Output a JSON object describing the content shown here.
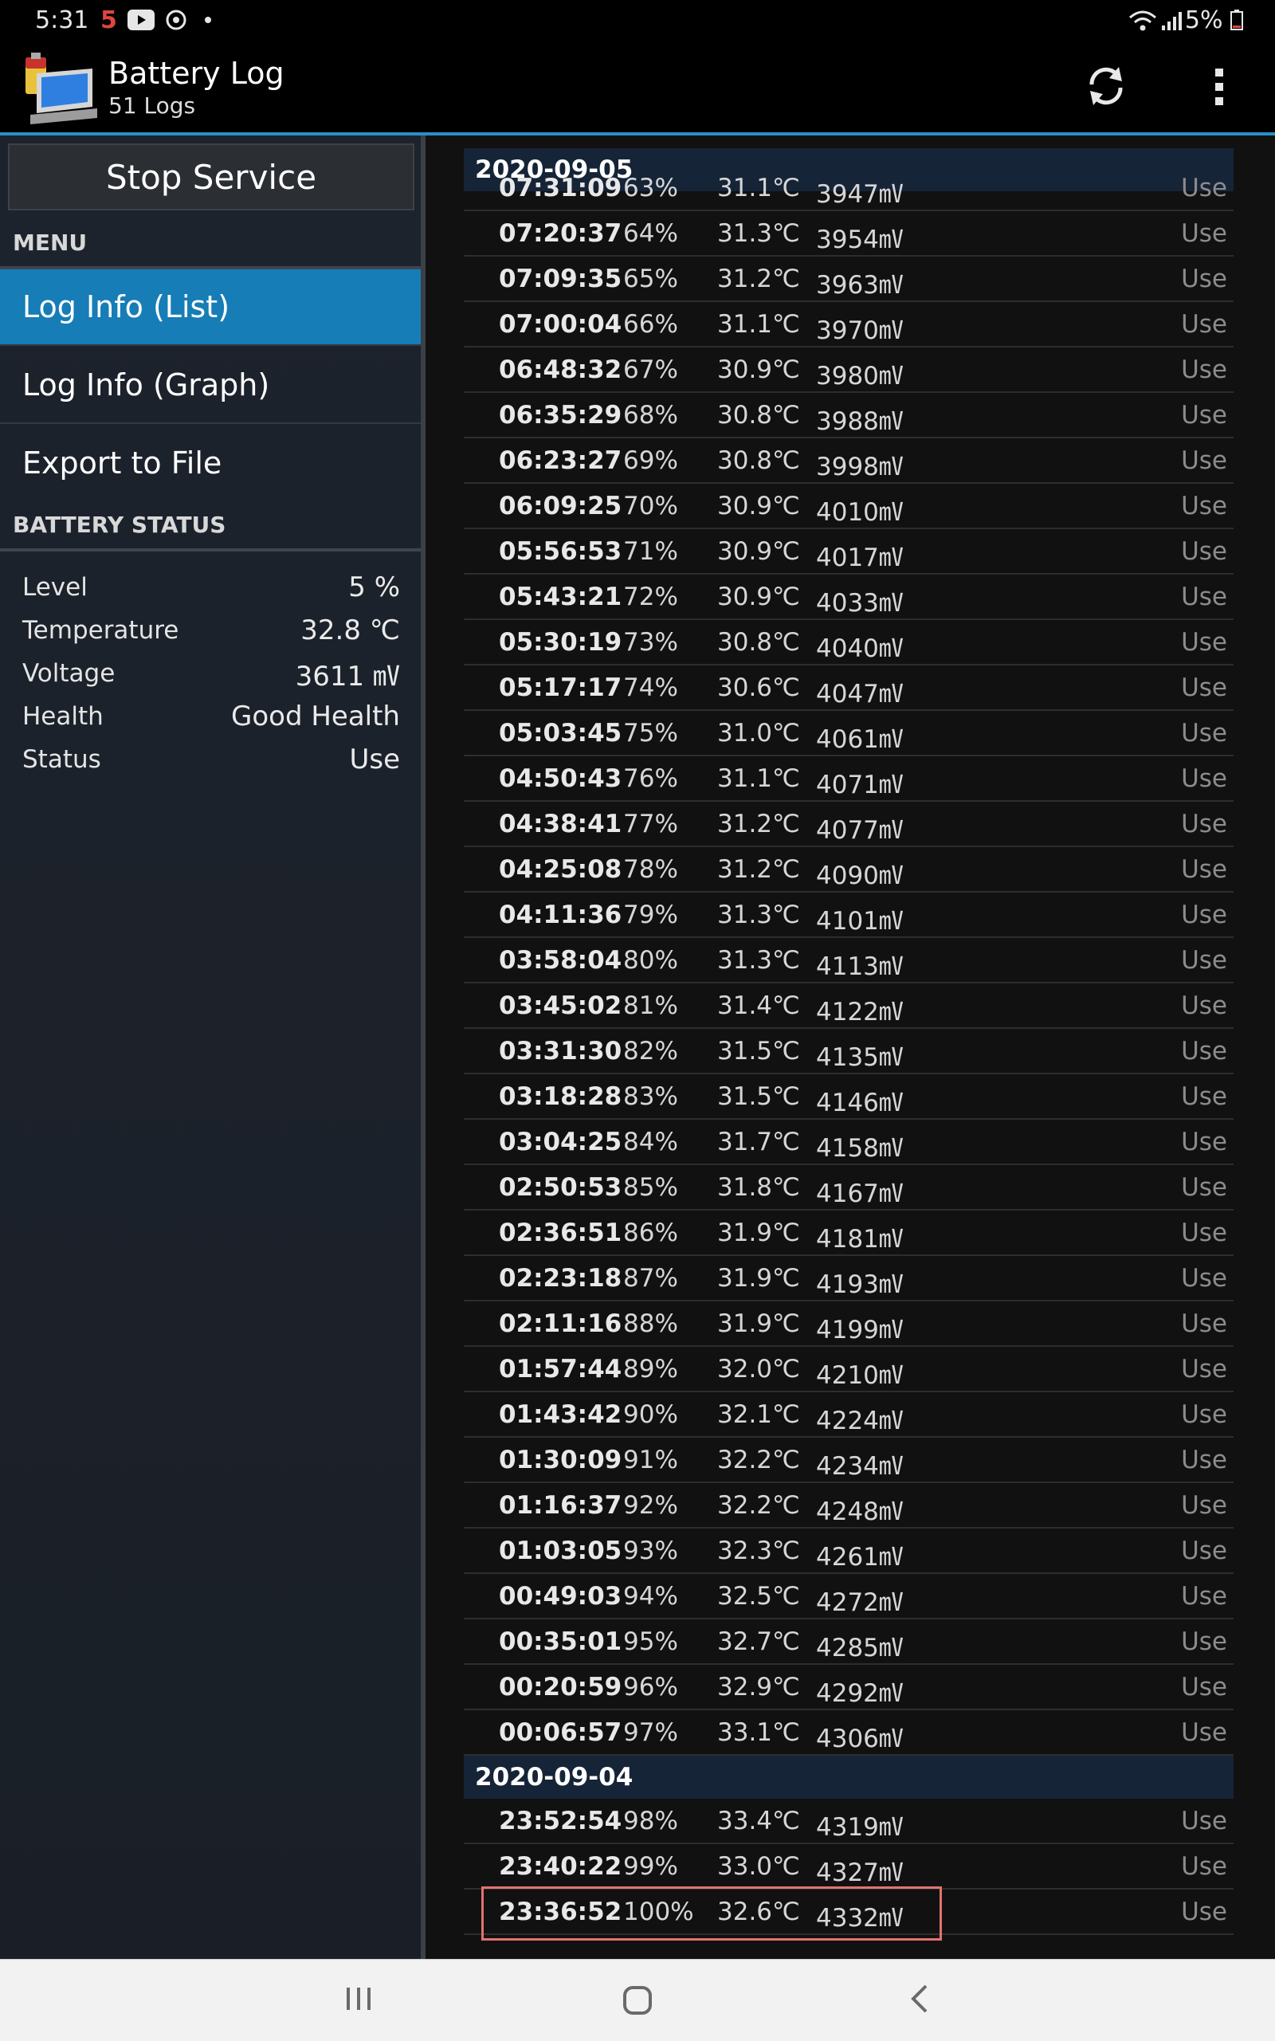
{
  "status_bar": {
    "time": "5:31",
    "notif_count": "5",
    "battery": "5%"
  },
  "app_bar": {
    "title": "Battery Log",
    "subtitle": "51 Logs"
  },
  "sidebar": {
    "stop_button": "Stop Service",
    "menu_header": "MENU",
    "menu_items": [
      "Log Info (List)",
      "Log Info (Graph)",
      "Export to File"
    ],
    "battery_header": "BATTERY STATUS",
    "battery_status": [
      {
        "label": "Level",
        "value": "5 %"
      },
      {
        "label": "Temperature",
        "value": "32.8 ℃"
      },
      {
        "label": "Voltage",
        "value": "3611 ㎷"
      },
      {
        "label": "Health",
        "value": "Good Health"
      },
      {
        "label": "Status",
        "value": "Use"
      }
    ]
  },
  "logs": {
    "date1": "2020-09-05",
    "date2": "2020-09-04",
    "group1": [
      {
        "time": "07:31:09",
        "level": "63%",
        "temp": "31.1℃",
        "volt": "3947㎷",
        "status": "Use"
      },
      {
        "time": "07:20:37",
        "level": "64%",
        "temp": "31.3℃",
        "volt": "3954㎷",
        "status": "Use"
      },
      {
        "time": "07:09:35",
        "level": "65%",
        "temp": "31.2℃",
        "volt": "3963㎷",
        "status": "Use"
      },
      {
        "time": "07:00:04",
        "level": "66%",
        "temp": "31.1℃",
        "volt": "3970㎷",
        "status": "Use"
      },
      {
        "time": "06:48:32",
        "level": "67%",
        "temp": "30.9℃",
        "volt": "3980㎷",
        "status": "Use"
      },
      {
        "time": "06:35:29",
        "level": "68%",
        "temp": "30.8℃",
        "volt": "3988㎷",
        "status": "Use"
      },
      {
        "time": "06:23:27",
        "level": "69%",
        "temp": "30.8℃",
        "volt": "3998㎷",
        "status": "Use"
      },
      {
        "time": "06:09:25",
        "level": "70%",
        "temp": "30.9℃",
        "volt": "4010㎷",
        "status": "Use"
      },
      {
        "time": "05:56:53",
        "level": "71%",
        "temp": "30.9℃",
        "volt": "4017㎷",
        "status": "Use"
      },
      {
        "time": "05:43:21",
        "level": "72%",
        "temp": "30.9℃",
        "volt": "4033㎷",
        "status": "Use"
      },
      {
        "time": "05:30:19",
        "level": "73%",
        "temp": "30.8℃",
        "volt": "4040㎷",
        "status": "Use"
      },
      {
        "time": "05:17:17",
        "level": "74%",
        "temp": "30.6℃",
        "volt": "4047㎷",
        "status": "Use"
      },
      {
        "time": "05:03:45",
        "level": "75%",
        "temp": "31.0℃",
        "volt": "4061㎷",
        "status": "Use"
      },
      {
        "time": "04:50:43",
        "level": "76%",
        "temp": "31.1℃",
        "volt": "4071㎷",
        "status": "Use"
      },
      {
        "time": "04:38:41",
        "level": "77%",
        "temp": "31.2℃",
        "volt": "4077㎷",
        "status": "Use"
      },
      {
        "time": "04:25:08",
        "level": "78%",
        "temp": "31.2℃",
        "volt": "4090㎷",
        "status": "Use"
      },
      {
        "time": "04:11:36",
        "level": "79%",
        "temp": "31.3℃",
        "volt": "4101㎷",
        "status": "Use"
      },
      {
        "time": "03:58:04",
        "level": "80%",
        "temp": "31.3℃",
        "volt": "4113㎷",
        "status": "Use"
      },
      {
        "time": "03:45:02",
        "level": "81%",
        "temp": "31.4℃",
        "volt": "4122㎷",
        "status": "Use"
      },
      {
        "time": "03:31:30",
        "level": "82%",
        "temp": "31.5℃",
        "volt": "4135㎷",
        "status": "Use"
      },
      {
        "time": "03:18:28",
        "level": "83%",
        "temp": "31.5℃",
        "volt": "4146㎷",
        "status": "Use"
      },
      {
        "time": "03:04:25",
        "level": "84%",
        "temp": "31.7℃",
        "volt": "4158㎷",
        "status": "Use"
      },
      {
        "time": "02:50:53",
        "level": "85%",
        "temp": "31.8℃",
        "volt": "4167㎷",
        "status": "Use"
      },
      {
        "time": "02:36:51",
        "level": "86%",
        "temp": "31.9℃",
        "volt": "4181㎷",
        "status": "Use"
      },
      {
        "time": "02:23:18",
        "level": "87%",
        "temp": "31.9℃",
        "volt": "4193㎷",
        "status": "Use"
      },
      {
        "time": "02:11:16",
        "level": "88%",
        "temp": "31.9℃",
        "volt": "4199㎷",
        "status": "Use"
      },
      {
        "time": "01:57:44",
        "level": "89%",
        "temp": "32.0℃",
        "volt": "4210㎷",
        "status": "Use"
      },
      {
        "time": "01:43:42",
        "level": "90%",
        "temp": "32.1℃",
        "volt": "4224㎷",
        "status": "Use"
      },
      {
        "time": "01:30:09",
        "level": "91%",
        "temp": "32.2℃",
        "volt": "4234㎷",
        "status": "Use"
      },
      {
        "time": "01:16:37",
        "level": "92%",
        "temp": "32.2℃",
        "volt": "4248㎷",
        "status": "Use"
      },
      {
        "time": "01:03:05",
        "level": "93%",
        "temp": "32.3℃",
        "volt": "4261㎷",
        "status": "Use"
      },
      {
        "time": "00:49:03",
        "level": "94%",
        "temp": "32.5℃",
        "volt": "4272㎷",
        "status": "Use"
      },
      {
        "time": "00:35:01",
        "level": "95%",
        "temp": "32.7℃",
        "volt": "4285㎷",
        "status": "Use"
      },
      {
        "time": "00:20:59",
        "level": "96%",
        "temp": "32.9℃",
        "volt": "4292㎷",
        "status": "Use"
      },
      {
        "time": "00:06:57",
        "level": "97%",
        "temp": "33.1℃",
        "volt": "4306㎷",
        "status": "Use"
      }
    ],
    "group2": [
      {
        "time": "23:52:54",
        "level": "98%",
        "temp": "33.4℃",
        "volt": "4319㎷",
        "status": "Use"
      },
      {
        "time": "23:40:22",
        "level": "99%",
        "temp": "33.0℃",
        "volt": "4327㎷",
        "status": "Use"
      },
      {
        "time": "23:36:52",
        "level": "100%",
        "temp": "32.6℃",
        "volt": "4332㎷",
        "status": "Use"
      }
    ]
  },
  "colors": {
    "accent": "#167db6",
    "appbar_line": "#2a8fc9",
    "date_header": "#162438",
    "highlight": "#e3726f"
  }
}
